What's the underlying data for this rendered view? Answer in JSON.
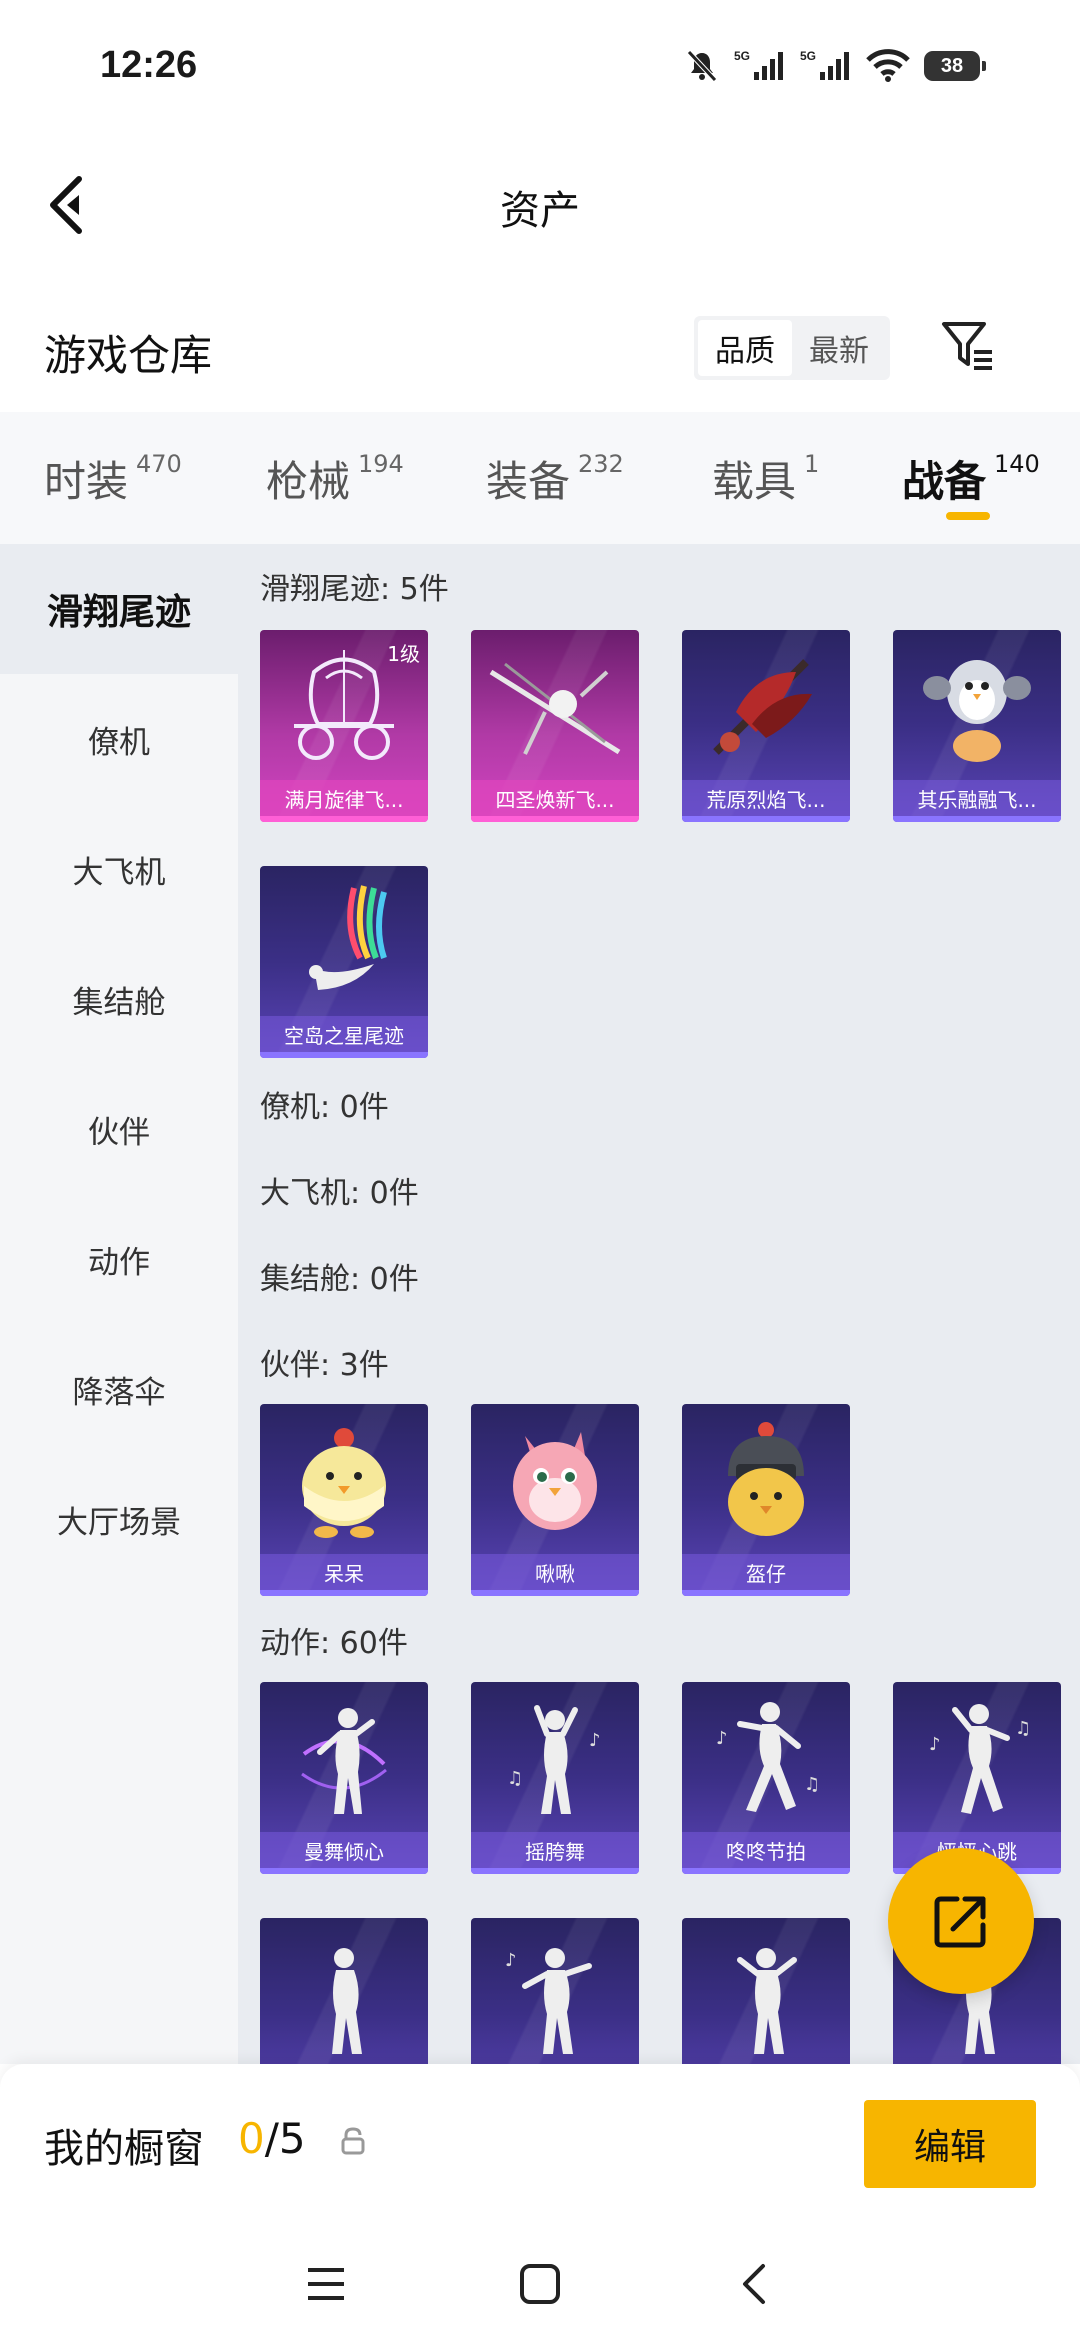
{
  "status_bar": {
    "time": "12:26",
    "battery": "38",
    "signal1_label": "5G",
    "signal2_label": "5G"
  },
  "header": {
    "title": "资产"
  },
  "warehouse": {
    "title": "游戏仓库",
    "sort_options": [
      "品质",
      "最新"
    ],
    "sort_selected": "品质"
  },
  "tabs": [
    {
      "label": "时装",
      "count": "470"
    },
    {
      "label": "枪械",
      "count": "194"
    },
    {
      "label": "装备",
      "count": "232"
    },
    {
      "label": "载具",
      "count": "1"
    },
    {
      "label": "战备",
      "count": "140"
    }
  ],
  "active_tab": "战备",
  "sidebar": {
    "items": [
      "滑翔尾迹",
      "僚机",
      "大飞机",
      "集结舱",
      "伙伴",
      "动作",
      "降落伞",
      "大厅场景"
    ],
    "active": "滑翔尾迹"
  },
  "sections": [
    {
      "title": "滑翔尾迹: 5件",
      "items": [
        {
          "label": "满月旋律飞...",
          "badge": "1级",
          "color": "pink",
          "icon": "carriage-icon"
        },
        {
          "label": "四圣焕新飞...",
          "color": "pink",
          "icon": "glider-wing-icon"
        },
        {
          "label": "荒原烈焰飞...",
          "color": "purple",
          "icon": "flame-glider-icon"
        },
        {
          "label": "其乐融融飞...",
          "color": "purple",
          "icon": "penguin-glider-icon"
        },
        {
          "label": "空岛之星尾迹",
          "color": "purple",
          "icon": "rainbow-trail-icon"
        }
      ]
    },
    {
      "title": "僚机: 0件",
      "items": []
    },
    {
      "title": "大飞机: 0件",
      "items": []
    },
    {
      "title": "集结舱: 0件",
      "items": []
    },
    {
      "title": "伙伴: 3件",
      "items": [
        {
          "label": "呆呆",
          "color": "purple",
          "icon": "chick-icon"
        },
        {
          "label": "啾啾",
          "color": "purple",
          "icon": "pink-bird-icon"
        },
        {
          "label": "盔仔",
          "color": "purple",
          "icon": "helmet-chick-icon"
        }
      ]
    },
    {
      "title": "动作: 60件",
      "items": [
        {
          "label": "曼舞倾心",
          "color": "purple",
          "icon": "dance-pose-icon"
        },
        {
          "label": "摇胯舞",
          "color": "purple",
          "icon": "dance-pose-icon"
        },
        {
          "label": "咚咚节拍",
          "color": "purple",
          "icon": "dance-pose-icon"
        },
        {
          "label": "怦怦心跳",
          "color": "purple",
          "icon": "dance-pose-icon"
        },
        {
          "label": "",
          "color": "purple",
          "icon": "dance-pose-icon"
        },
        {
          "label": "",
          "color": "purple",
          "icon": "dance-pose-icon"
        },
        {
          "label": "",
          "color": "purple",
          "icon": "dance-pose-icon"
        },
        {
          "label": "",
          "color": "purple",
          "icon": "dance-pose-icon"
        }
      ]
    }
  ],
  "showcase": {
    "title": "我的橱窗",
    "current": "0",
    "total": "/5",
    "edit_label": "编辑"
  },
  "colors": {
    "accent": "#f7b500",
    "card_purple": "#3b2f86",
    "card_pink": "#b13aa6"
  }
}
